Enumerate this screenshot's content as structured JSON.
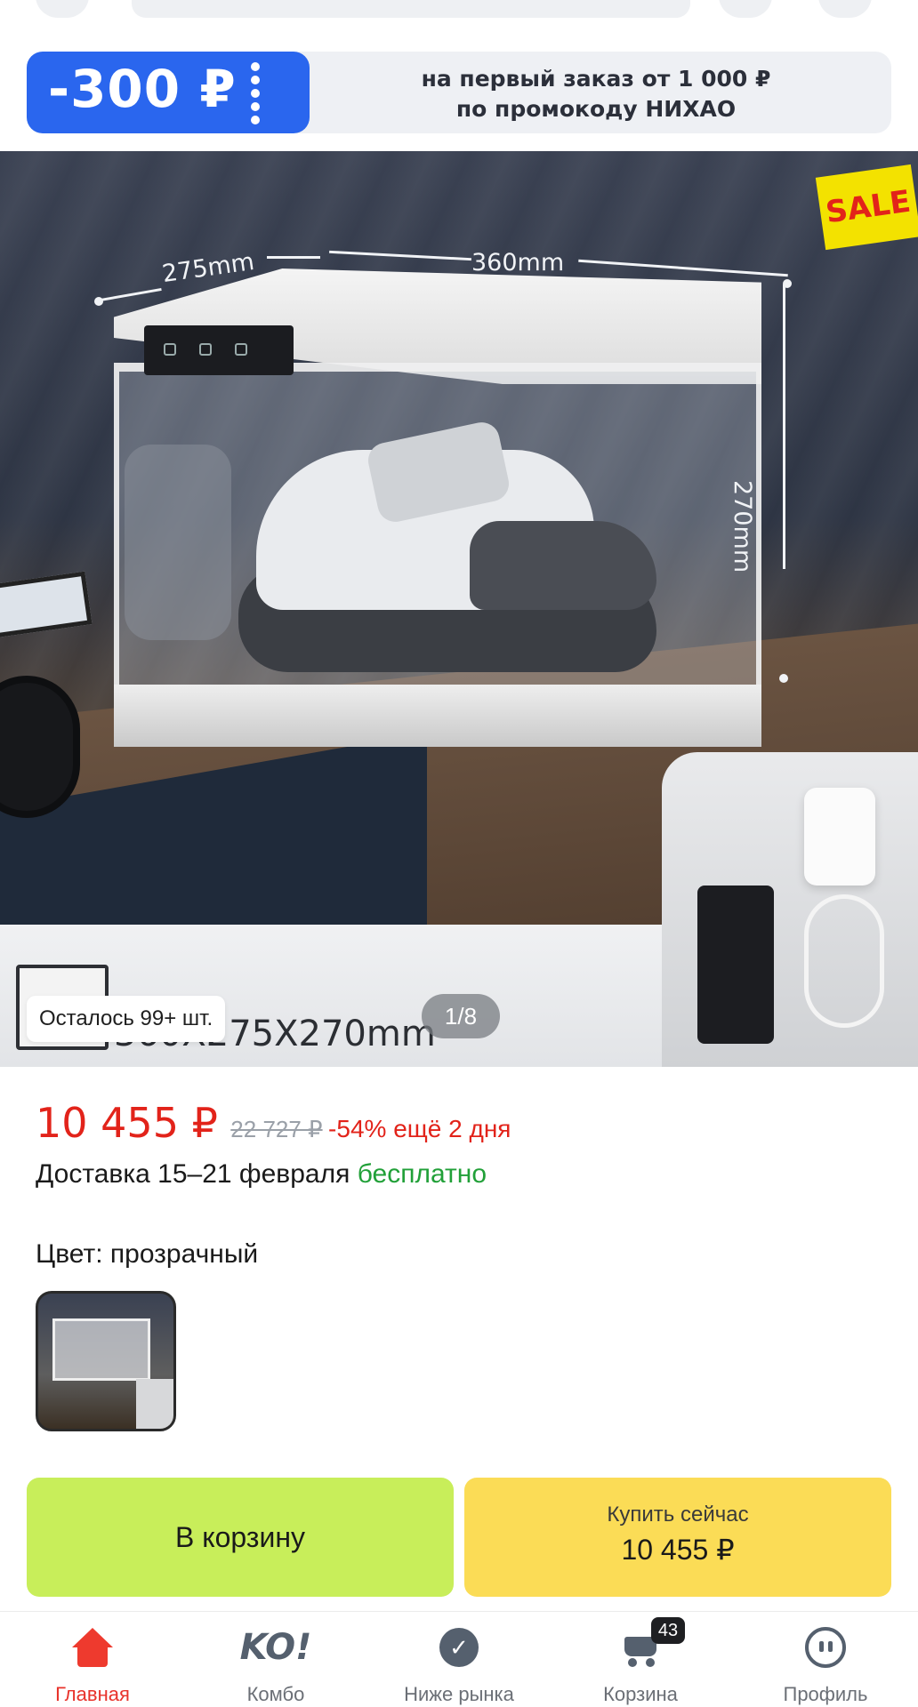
{
  "promo": {
    "amount": "-300 ₽",
    "line1": "на первый заказ от 1 000 ₽",
    "line2": "по промокоду НИХАО"
  },
  "gallery": {
    "badge": "SALE",
    "dim_depth": "275mm",
    "dim_width": "360mm",
    "dim_height": "270mm",
    "stock": "Осталось 99+ шт.",
    "caption": "360X275X270mm",
    "counter": "1/8"
  },
  "product": {
    "price": "10 455 ₽",
    "old_price": "22 727 ₽",
    "discount": "-54% ещё 2 дня",
    "delivery_text": "Доставка 15–21 февраля",
    "delivery_free": "бесплатно",
    "color_label": "Цвет: прозрачный"
  },
  "actions": {
    "cart": "В корзину",
    "buy_label": "Купить сейчас",
    "buy_price": "10 455 ₽"
  },
  "tabs": [
    {
      "label": "Главная",
      "icon": "home-icon"
    },
    {
      "label": "Комбо",
      "icon": "ko-icon"
    },
    {
      "label": "Ниже рынка",
      "icon": "check-badge-icon"
    },
    {
      "label": "Корзина",
      "icon": "cart-icon",
      "count": "43"
    },
    {
      "label": "Профиль",
      "icon": "profile-icon"
    }
  ],
  "colors": {
    "accent_red": "#e2231a",
    "promo_blue": "#2a66ee",
    "cart_green": "#c8ee5a",
    "buy_yellow": "#fbdc56",
    "free_green": "#21a038"
  }
}
